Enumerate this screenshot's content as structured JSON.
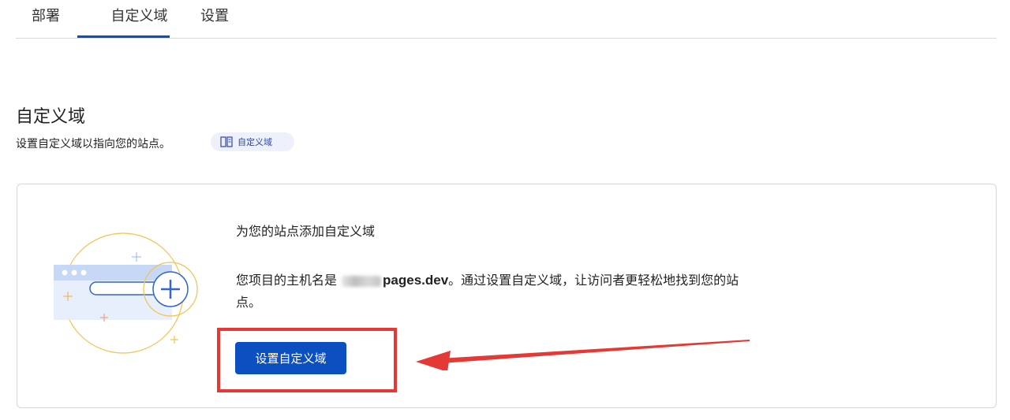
{
  "tabs": [
    {
      "label": "部署"
    },
    {
      "label": "自定义域"
    },
    {
      "label": "设置"
    }
  ],
  "section": {
    "title": "自定义域",
    "description": "设置自定义域以指向您的站点。",
    "doc_pill_label": "自定义域"
  },
  "card": {
    "heading": "为您的站点添加自定义域",
    "body_prefix": "您项目的主机名是",
    "hostname_visible": "pages.dev",
    "body_suffix": "。通过设置自定义域，让访问者更轻松地找到您的站点。",
    "button_label": "设置自定义域"
  },
  "colors": {
    "accent": "#0b4fc1",
    "annotation": "#e53935"
  }
}
